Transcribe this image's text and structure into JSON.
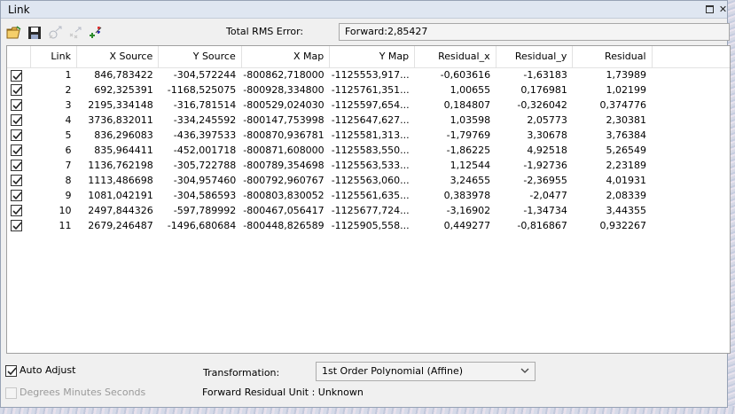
{
  "window": {
    "title": "Link"
  },
  "toolbar": {
    "icons": [
      "open-folder-icon",
      "save-icon",
      "delete-link-icon",
      "delete-all-links-icon",
      "add-link-icon"
    ]
  },
  "rms": {
    "label": "Total RMS Error:",
    "value": "Forward:2,85427"
  },
  "table": {
    "headers": [
      "Link",
      "X Source",
      "Y Source",
      "X Map",
      "Y Map",
      "Residual_x",
      "Residual_y",
      "Residual"
    ],
    "rows": [
      {
        "link": "1",
        "x_source": "846,783422",
        "y_source": "-304,572244",
        "x_map": "-800862,718000",
        "y_map": "-1125553,917...",
        "res_x": "-0,603616",
        "res_y": "-1,63183",
        "res": "1,73989"
      },
      {
        "link": "2",
        "x_source": "692,325391",
        "y_source": "-1168,525075",
        "x_map": "-800928,334800",
        "y_map": "-1125761,351...",
        "res_x": "1,00655",
        "res_y": "0,176981",
        "res": "1,02199"
      },
      {
        "link": "3",
        "x_source": "2195,334148",
        "y_source": "-316,781514",
        "x_map": "-800529,024030",
        "y_map": "-1125597,654...",
        "res_x": "0,184807",
        "res_y": "-0,326042",
        "res": "0,374776"
      },
      {
        "link": "4",
        "x_source": "3736,832011",
        "y_source": "-334,245592",
        "x_map": "-800147,753998",
        "y_map": "-1125647,627...",
        "res_x": "1,03598",
        "res_y": "2,05773",
        "res": "2,30381"
      },
      {
        "link": "5",
        "x_source": "836,296083",
        "y_source": "-436,397533",
        "x_map": "-800870,936781",
        "y_map": "-1125581,313...",
        "res_x": "-1,79769",
        "res_y": "3,30678",
        "res": "3,76384"
      },
      {
        "link": "6",
        "x_source": "835,964411",
        "y_source": "-452,001718",
        "x_map": "-800871,608000",
        "y_map": "-1125583,550...",
        "res_x": "-1,86225",
        "res_y": "4,92518",
        "res": "5,26549"
      },
      {
        "link": "7",
        "x_source": "1136,762198",
        "y_source": "-305,722788",
        "x_map": "-800789,354698",
        "y_map": "-1125563,533...",
        "res_x": "1,12544",
        "res_y": "-1,92736",
        "res": "2,23189"
      },
      {
        "link": "8",
        "x_source": "1113,486698",
        "y_source": "-304,957460",
        "x_map": "-800792,960767",
        "y_map": "-1125563,060...",
        "res_x": "3,24655",
        "res_y": "-2,36955",
        "res": "4,01931"
      },
      {
        "link": "9",
        "x_source": "1081,042191",
        "y_source": "-304,586593",
        "x_map": "-800803,830052",
        "y_map": "-1125561,635...",
        "res_x": "0,383978",
        "res_y": "-2,0477",
        "res": "2,08339"
      },
      {
        "link": "10",
        "x_source": "2497,844326",
        "y_source": "-597,789992",
        "x_map": "-800467,056417",
        "y_map": "-1125677,724...",
        "res_x": "-3,16902",
        "res_y": "-1,34734",
        "res": "3,44355"
      },
      {
        "link": "11",
        "x_source": "2679,246487",
        "y_source": "-1496,680684",
        "x_map": "-800448,826589",
        "y_map": "-1125905,558...",
        "res_x": "0,449277",
        "res_y": "-0,816867",
        "res": "0,932267"
      }
    ]
  },
  "options": {
    "auto_adjust": {
      "label": "Auto Adjust",
      "checked": true
    },
    "dms": {
      "label": "Degrees Minutes Seconds",
      "checked": false,
      "enabled": false
    },
    "transformation": {
      "label": "Transformation:",
      "value": "1st Order Polynomial (Affine)"
    },
    "residual_unit": "Forward Residual Unit : Unknown"
  }
}
